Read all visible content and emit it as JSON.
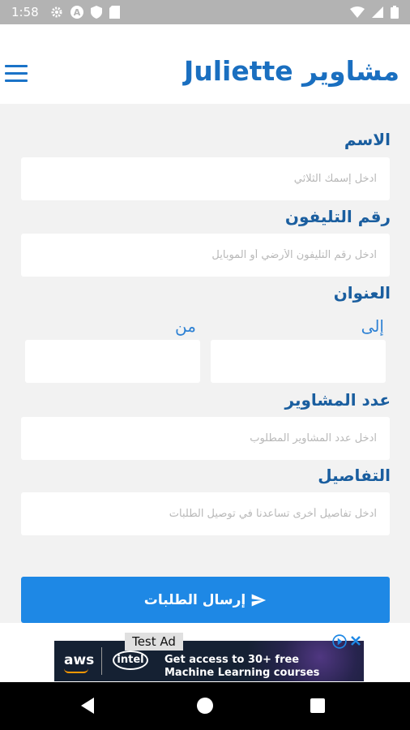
{
  "status_bar": {
    "time": "1:58"
  },
  "header": {
    "title": "مشاوير Juliette"
  },
  "form": {
    "name_label": "الاسم",
    "name_placeholder": "ادخل إسمك الثلاثي",
    "phone_label": "رقم التليفون",
    "phone_placeholder": "ادخل رقم التليفون الأرضي أو الموبايل",
    "address_label": "العنوان",
    "to_label": "إلى",
    "from_label": "من",
    "trips_label": "عدد المشاوير",
    "trips_placeholder": "ادخل عدد المشاوير المطلوب",
    "details_label": "التفاصيل",
    "details_placeholder": "ادخل تفاصيل أخرى تساعدنا في توصيل الطلبات",
    "submit_label": "إرسال الطلبات"
  },
  "ad": {
    "badge": "Test Ad",
    "brand1": "aws",
    "brand2": "intel",
    "text": "Get access to 30+ free Machine Learning courses"
  },
  "colors": {
    "accent": "#1e88e5",
    "title": "#1a6fc0",
    "label": "#1a5e9f"
  }
}
